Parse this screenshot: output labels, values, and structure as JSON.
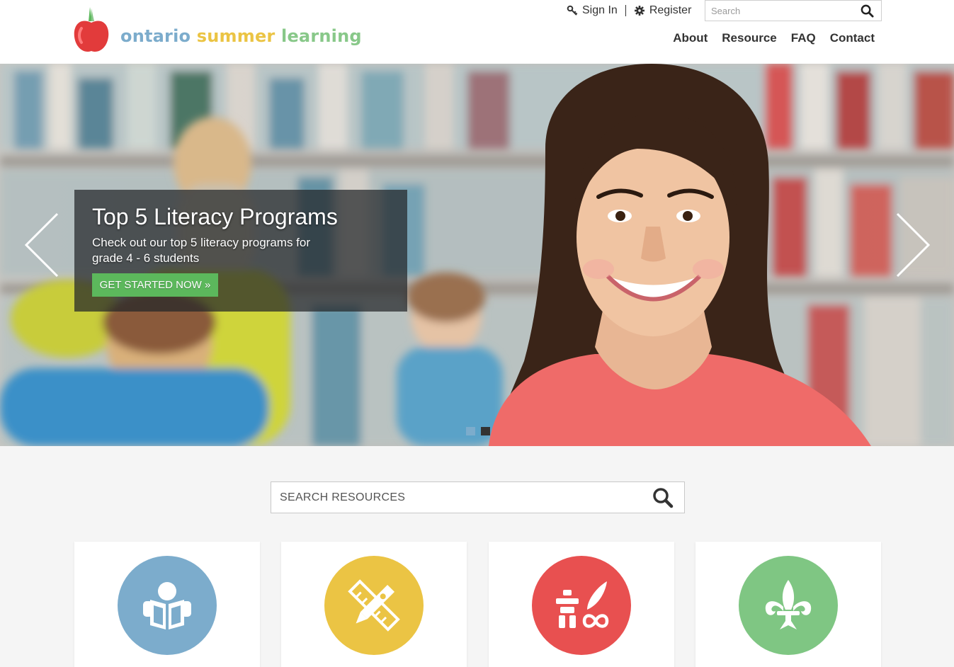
{
  "brand": {
    "word1": "ontario",
    "word2": "summer",
    "word3": "learning",
    "colors": {
      "blue": "#7caccc",
      "yellow": "#ebc444",
      "green": "#88c889",
      "red": "#e85050"
    }
  },
  "top_links": {
    "sign_in": "Sign In",
    "register": "Register"
  },
  "header_search": {
    "placeholder": "Search"
  },
  "nav": [
    "About",
    "Resource",
    "FAQ",
    "Contact"
  ],
  "hero": {
    "title": "Top 5 Literacy Programs",
    "text": "Check out our top 5 literacy programs for grade 4 - 6 students",
    "cta": "GET STARTED NOW »",
    "slides_total": 2,
    "active_slide": 1
  },
  "resource_search": {
    "placeholder": "SEARCH RESOURCES"
  },
  "cards": [
    {
      "icon": "reading-book-icon",
      "color": "#7caccc"
    },
    {
      "icon": "pencil-ruler-icon",
      "color": "#ebc444"
    },
    {
      "icon": "inukshuk-infinity-icon",
      "color": "#e85050"
    },
    {
      "icon": "fleur-de-lis-icon",
      "color": "#7fc683"
    }
  ]
}
